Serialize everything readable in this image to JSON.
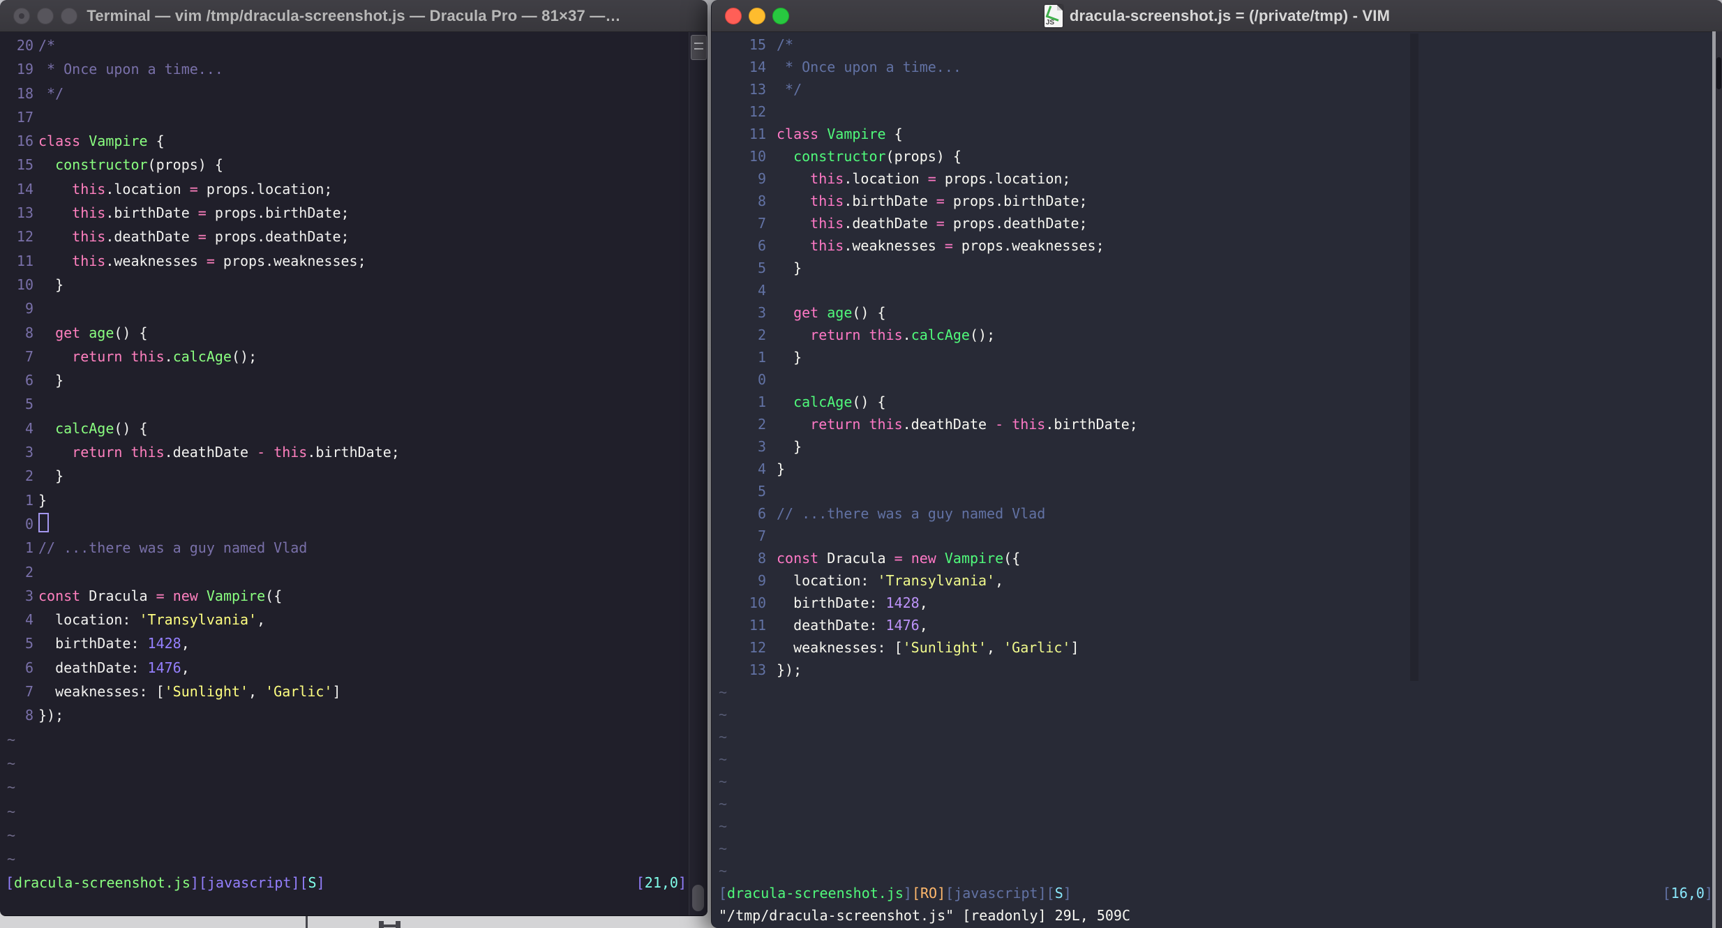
{
  "left_window": {
    "title": "Terminal — vim /tmp/dracula-screenshot.js — Dracula Pro — 81×37 —…",
    "traffic_lights": [
      "close",
      "minimize",
      "zoom"
    ],
    "palette": {
      "bg": "#201F2A",
      "fg": "#F2F2F0",
      "comment": "#7970A9",
      "pink": "#FF80BF",
      "green": "#8AFF80",
      "yellow": "#FFFF80",
      "purple": "#9580FF",
      "cyan": "#80FFEA",
      "linenr": "#7970A9",
      "tilde": "#6F6A8A",
      "cursor_outline": "#A497EE"
    },
    "line_numbers": [
      "20",
      "19",
      "18",
      "17",
      "16",
      "15",
      "14",
      "13",
      "12",
      "11",
      "10",
      "9",
      "8",
      "7",
      "6",
      "5",
      "4",
      "3",
      "2",
      "1",
      "0",
      "1",
      "2",
      "3",
      "4",
      "5",
      "6",
      "7",
      "8"
    ],
    "cursor_line_index": 20,
    "cursor_visible": true,
    "tilde_char": "~",
    "tilde_count": 6,
    "status_segments": [
      [
        "[",
        "purple"
      ],
      [
        "dracula-screenshot.js",
        "green"
      ],
      [
        "][",
        "purple"
      ],
      [
        "javascript",
        "purple"
      ],
      [
        "][",
        "purple"
      ],
      [
        "S",
        "cyan"
      ],
      [
        "]",
        "purple"
      ]
    ],
    "ruler_segments": [
      [
        "[",
        "purple"
      ],
      [
        "21,0",
        "cyan"
      ],
      [
        "]",
        "purple"
      ]
    ],
    "command_line": ""
  },
  "right_window": {
    "title": "dracula-screenshot.js = (/private/tmp) - VIM",
    "file_icon_label": "JS",
    "traffic_lights": [
      "close",
      "minimize",
      "zoom"
    ],
    "traffic_colors": [
      "#FF5F57",
      "#FEBC2E",
      "#28C840"
    ],
    "palette": {
      "bg": "#282A36",
      "fg": "#F8F8F2",
      "comment": "#6272A4",
      "pink": "#FF79C6",
      "green": "#50FA7B",
      "yellow": "#F1FA8C",
      "purple": "#BD93F9",
      "cyan": "#8BE9FD",
      "orange": "#FFB86C",
      "linenr": "#6272A4",
      "tilde": "#565B74"
    },
    "line_numbers": [
      "15",
      "14",
      "13",
      "12",
      "11",
      "10",
      "9",
      "8",
      "7",
      "6",
      "5",
      "4",
      "3",
      "2",
      "1",
      "0",
      "1",
      "2",
      "3",
      "4",
      "5",
      "6",
      "7",
      "8",
      "9",
      "10",
      "11",
      "12",
      "13"
    ],
    "cursor_line_index": 15,
    "cursor_visible": false,
    "tilde_char": "~",
    "tilde_count": 9,
    "status_segments": [
      [
        "[",
        "comment"
      ],
      [
        "dracula-screenshot.js",
        "green"
      ],
      [
        "]",
        "comment"
      ],
      [
        "[RO]",
        "orange"
      ],
      [
        "[",
        "comment"
      ],
      [
        "javascript",
        "comment"
      ],
      [
        "][",
        "comment"
      ],
      [
        "S",
        "cyan"
      ],
      [
        "]",
        "comment"
      ]
    ],
    "ruler_segments": [
      [
        "[",
        "comment"
      ],
      [
        "16,0",
        "cyan"
      ],
      [
        "]",
        "comment"
      ]
    ],
    "command_line": "\"/tmp/dracula-screenshot.js\" [readonly] 29L, 509C"
  },
  "code_lines": [
    {
      "segs": [
        [
          "/*",
          "comment"
        ]
      ]
    },
    {
      "segs": [
        [
          " * Once upon a time...",
          "comment"
        ]
      ]
    },
    {
      "segs": [
        [
          " */",
          "comment"
        ]
      ]
    },
    {
      "segs": []
    },
    {
      "segs": [
        [
          "class",
          "pink"
        ],
        [
          " ",
          "fg"
        ],
        [
          "Vampire",
          "green"
        ],
        [
          " {",
          "fg"
        ]
      ]
    },
    {
      "segs": [
        [
          "  ",
          "fg"
        ],
        [
          "constructor",
          "green"
        ],
        [
          "(props) {",
          "fg"
        ]
      ]
    },
    {
      "segs": [
        [
          "    ",
          "fg"
        ],
        [
          "this",
          "pink"
        ],
        [
          ".location ",
          "fg"
        ],
        [
          "=",
          "pink"
        ],
        [
          " props.location;",
          "fg"
        ]
      ]
    },
    {
      "segs": [
        [
          "    ",
          "fg"
        ],
        [
          "this",
          "pink"
        ],
        [
          ".birthDate ",
          "fg"
        ],
        [
          "=",
          "pink"
        ],
        [
          " props.birthDate;",
          "fg"
        ]
      ]
    },
    {
      "segs": [
        [
          "    ",
          "fg"
        ],
        [
          "this",
          "pink"
        ],
        [
          ".deathDate ",
          "fg"
        ],
        [
          "=",
          "pink"
        ],
        [
          " props.deathDate;",
          "fg"
        ]
      ]
    },
    {
      "segs": [
        [
          "    ",
          "fg"
        ],
        [
          "this",
          "pink"
        ],
        [
          ".weaknesses ",
          "fg"
        ],
        [
          "=",
          "pink"
        ],
        [
          " props.weaknesses;",
          "fg"
        ]
      ]
    },
    {
      "segs": [
        [
          "  }",
          "fg"
        ]
      ]
    },
    {
      "segs": []
    },
    {
      "segs": [
        [
          "  ",
          "fg"
        ],
        [
          "get",
          "pink"
        ],
        [
          " ",
          "fg"
        ],
        [
          "age",
          "green"
        ],
        [
          "() {",
          "fg"
        ]
      ]
    },
    {
      "segs": [
        [
          "    ",
          "fg"
        ],
        [
          "return",
          "pink"
        ],
        [
          " ",
          "fg"
        ],
        [
          "this",
          "pink"
        ],
        [
          ".",
          "fg"
        ],
        [
          "calcAge",
          "green"
        ],
        [
          "();",
          "fg"
        ]
      ]
    },
    {
      "segs": [
        [
          "  }",
          "fg"
        ]
      ]
    },
    {
      "segs": []
    },
    {
      "segs": [
        [
          "  ",
          "fg"
        ],
        [
          "calcAge",
          "green"
        ],
        [
          "() {",
          "fg"
        ]
      ]
    },
    {
      "segs": [
        [
          "    ",
          "fg"
        ],
        [
          "return",
          "pink"
        ],
        [
          " ",
          "fg"
        ],
        [
          "this",
          "pink"
        ],
        [
          ".deathDate ",
          "fg"
        ],
        [
          "-",
          "pink"
        ],
        [
          " ",
          "fg"
        ],
        [
          "this",
          "pink"
        ],
        [
          ".birthDate;",
          "fg"
        ]
      ]
    },
    {
      "segs": [
        [
          "  }",
          "fg"
        ]
      ]
    },
    {
      "segs": [
        [
          "}",
          "fg"
        ]
      ]
    },
    {
      "segs": []
    },
    {
      "segs": [
        [
          "// ...there was a guy named Vlad",
          "comment"
        ]
      ]
    },
    {
      "segs": []
    },
    {
      "segs": [
        [
          "const",
          "pink"
        ],
        [
          " Dracula ",
          "fg"
        ],
        [
          "=",
          "pink"
        ],
        [
          " ",
          "fg"
        ],
        [
          "new",
          "pink"
        ],
        [
          " ",
          "fg"
        ],
        [
          "Vampire",
          "green"
        ],
        [
          "({",
          "fg"
        ]
      ]
    },
    {
      "segs": [
        [
          "  location: ",
          "fg"
        ],
        [
          "'Transylvania'",
          "yellow"
        ],
        [
          ",",
          "fg"
        ]
      ]
    },
    {
      "segs": [
        [
          "  birthDate: ",
          "fg"
        ],
        [
          "1428",
          "purple"
        ],
        [
          ",",
          "fg"
        ]
      ]
    },
    {
      "segs": [
        [
          "  deathDate: ",
          "fg"
        ],
        [
          "1476",
          "purple"
        ],
        [
          ",",
          "fg"
        ]
      ]
    },
    {
      "segs": [
        [
          "  weaknesses: [",
          "fg"
        ],
        [
          "'Sunlight'",
          "yellow"
        ],
        [
          ", ",
          "fg"
        ],
        [
          "'Garlic'",
          "yellow"
        ],
        [
          "]",
          "fg"
        ]
      ]
    },
    {
      "segs": [
        [
          "});",
          "fg"
        ]
      ]
    }
  ]
}
